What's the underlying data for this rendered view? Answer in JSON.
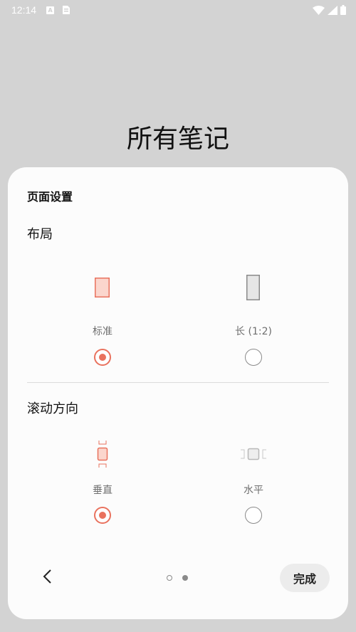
{
  "status_bar": {
    "time": "12:14",
    "icons": [
      "a-icon",
      "sim-icon",
      "wifi-icon",
      "signal-icon",
      "battery-icon"
    ]
  },
  "page_title": "所有笔记",
  "sheet": {
    "title": "页面设置",
    "layout": {
      "title": "布局",
      "options": [
        {
          "label": "标准",
          "selected": true
        },
        {
          "label": "长 (1:2)",
          "selected": false
        }
      ]
    },
    "scroll": {
      "title": "滚动方向",
      "options": [
        {
          "label": "垂直",
          "selected": true
        },
        {
          "label": "水平",
          "selected": false
        }
      ]
    },
    "pager": {
      "count": 2,
      "current": 2
    },
    "done_label": "完成"
  },
  "colors": {
    "accent": "#e9725e",
    "background": "#d3d3d3",
    "sheet": "#fcfcfc"
  }
}
